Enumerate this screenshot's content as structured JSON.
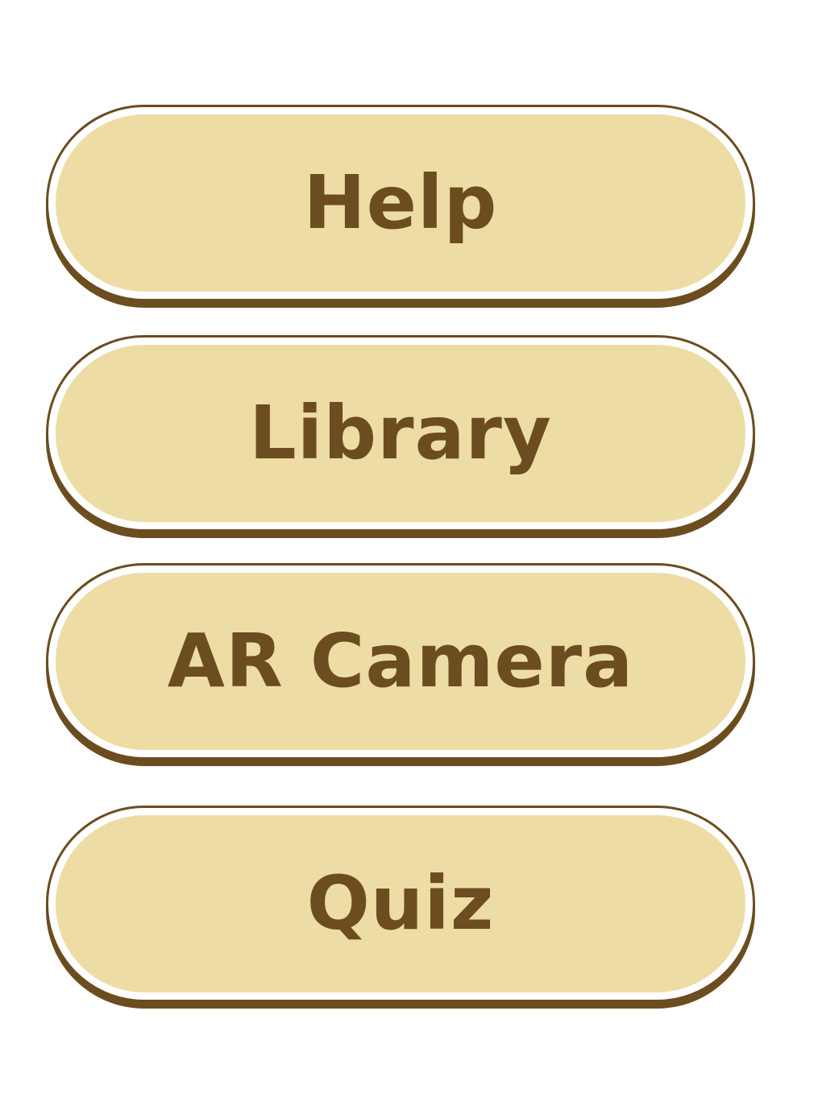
{
  "menu": {
    "help_label": "Help",
    "library_label": "Library",
    "ar_camera_label": "AR Camera",
    "quiz_label": "Quiz"
  },
  "colors": {
    "button_fill": "#eddda5",
    "button_border": "#6b4d1f",
    "button_text": "#6b4d1f",
    "background": "#ffffff"
  }
}
